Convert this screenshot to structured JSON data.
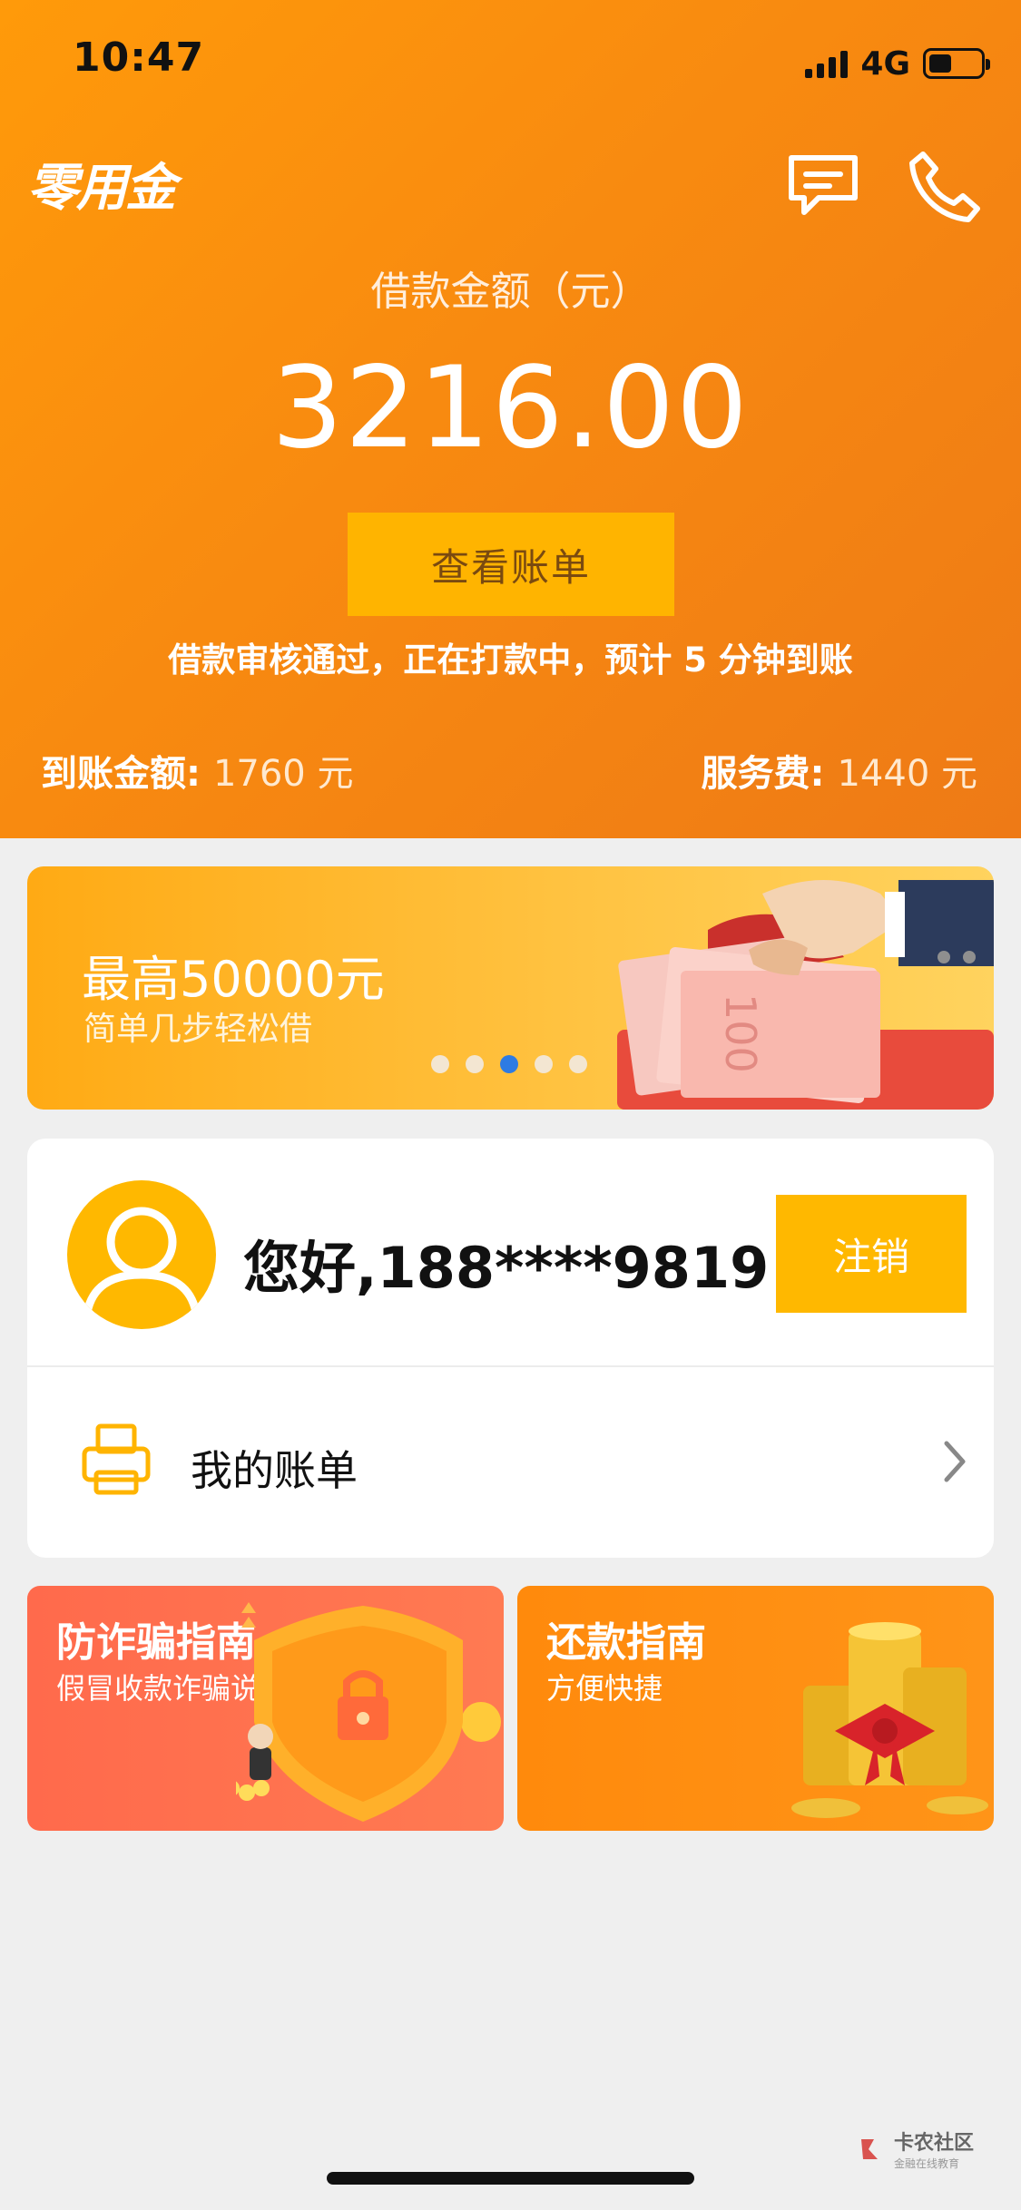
{
  "status_bar": {
    "time": "10:47",
    "network": "4G",
    "battery_level": 0.45
  },
  "header": {
    "app_name": "零用金",
    "loan_label": "借款金额（元）",
    "loan_amount": "3216.00",
    "view_bill_label": "查看账单",
    "notice": "借款审核通过，正在打款中，预计 5 分钟到账",
    "received_label": "到账金额:",
    "received_value": "1760 元",
    "fee_label": "服务费:",
    "fee_value": "1440 元",
    "icons": [
      "message-icon",
      "phone-icon"
    ]
  },
  "banner": {
    "title": "最高50000元",
    "subtitle": "简单几步轻松借",
    "active_slide": 3,
    "slide_count": 5
  },
  "user": {
    "greeting": "您好,188****9819",
    "logout_label": "注销",
    "bill_row_label": "我的账单"
  },
  "cards": {
    "fraud": {
      "title": "防诈骗指南",
      "subtitle": "假冒收款诈骗说明"
    },
    "repay": {
      "title": "还款指南",
      "subtitle": "方便快捷"
    }
  },
  "watermark": {
    "main": "卡农社区",
    "sub": "金融在线教育"
  },
  "colors": {
    "primary": "#ff9a0a",
    "button": "#ffb400",
    "fraud_card": "#ff6a4c",
    "dot_active": "#2e7be3"
  }
}
